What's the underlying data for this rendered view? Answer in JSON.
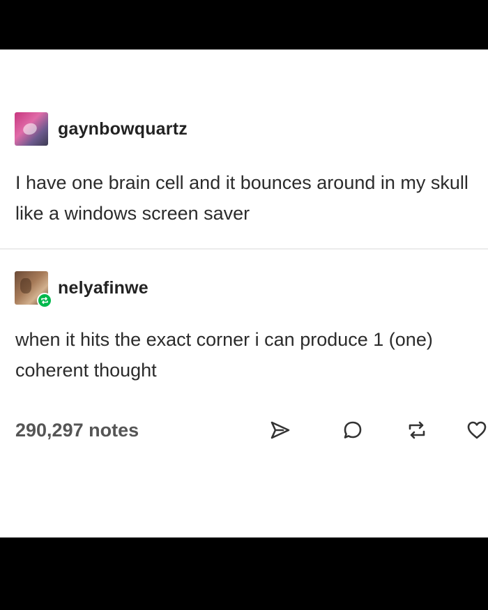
{
  "post": {
    "original": {
      "username": "gaynbowquartz",
      "avatar_icon": "avatar-image",
      "text": "I have one brain cell and it bounces around in my skull like a windows screen saver"
    },
    "reply": {
      "username": "nelyafinwe",
      "avatar_icon": "avatar-image",
      "badge_icon": "reblog-badge-icon",
      "text": "when it hits the exact corner i can produce 1 (one) coherent thought"
    },
    "footer": {
      "notes": "290,297 notes",
      "actions": [
        "share-icon",
        "reply-icon",
        "reblog-icon",
        "like-icon"
      ]
    }
  },
  "colors": {
    "background": "#000000",
    "card": "#ffffff",
    "text": "#2b2b2b",
    "reblog_badge": "#00b84c",
    "icon_stroke": "#333333"
  }
}
